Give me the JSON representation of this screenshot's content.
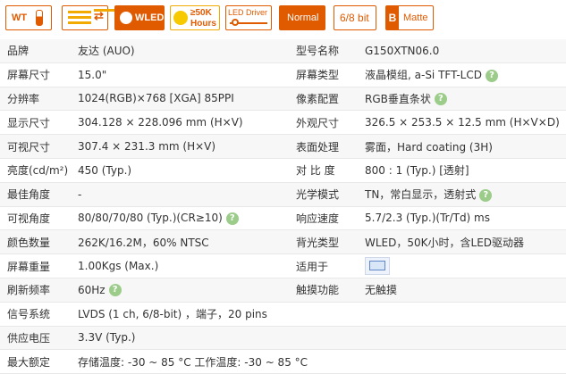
{
  "badges": {
    "wt": "WT",
    "wled": "WLED",
    "hours_line1": "≥50K",
    "hours_line2": "Hours",
    "driver": "LED Driver",
    "normal": "Normal",
    "bit": "6/8 bit",
    "matte_letter": "B",
    "matte": "Matte"
  },
  "rows": [
    {
      "l1": "品牌",
      "v1": "友达 (AUO)",
      "l2": "型号名称",
      "v2": "G150XTN06.0"
    },
    {
      "l1": "屏幕尺寸",
      "v1": "15.0\"",
      "l2": "屏幕类型",
      "v2": "液晶模组,   a-Si TFT-LCD"
    },
    {
      "l1": "分辨率",
      "v1": "1024(RGB)×768  [XGA]  85PPI",
      "l2": "像素配置",
      "v2": "RGB垂直条状"
    },
    {
      "l1": "显示尺寸",
      "v1": "304.128 × 228.096 mm (H×V)",
      "l2": "外观尺寸",
      "v2": "326.5 × 253.5 × 12.5 mm (H×V×D)"
    },
    {
      "l1": "可视尺寸",
      "v1": "307.4 × 231.3 mm (H×V)",
      "l2": "表面处理",
      "v2": "雾面，Hard coating (3H)"
    },
    {
      "l1": "亮度(cd/m²)",
      "v1": "450 (Typ.)",
      "l2": "对 比 度",
      "v2": "800 : 1 (Typ.) [透射]"
    },
    {
      "l1": "最佳角度",
      "v1": "-",
      "l2": "光学模式",
      "v2": "TN，常白显示，透射式"
    },
    {
      "l1": "可视角度",
      "v1": "80/80/70/80 (Typ.)(CR≥10)",
      "l2": "响应速度",
      "v2": "5.7/2.3 (Typ.)(Tr/Td) ms"
    },
    {
      "l1": "颜色数量",
      "v1": "262K/16.2M，60% NTSC",
      "l2": "背光类型",
      "v2": "WLED，50K小时，含LED驱动器"
    },
    {
      "l1": "屏幕重量",
      "v1": "1.00Kgs (Max.)",
      "l2": "适用于",
      "v2": ""
    },
    {
      "l1": "刷新频率",
      "v1": "60Hz",
      "l2": "触摸功能",
      "v2": "无触摸"
    },
    {
      "l1": "信号系统",
      "v1": "LVDS (1 ch, 6/8-bit) ，端子，20 pins",
      "l2": "",
      "v2": ""
    },
    {
      "l1": "供应电压",
      "v1": "3.3V (Typ.)",
      "l2": "",
      "v2": ""
    },
    {
      "l1": "最大额定",
      "v1": "存储温度: -30 ~ 85 °C    工作温度: -30 ~ 85 °C",
      "l2": "",
      "v2": ""
    }
  ],
  "help_glyph": "?"
}
